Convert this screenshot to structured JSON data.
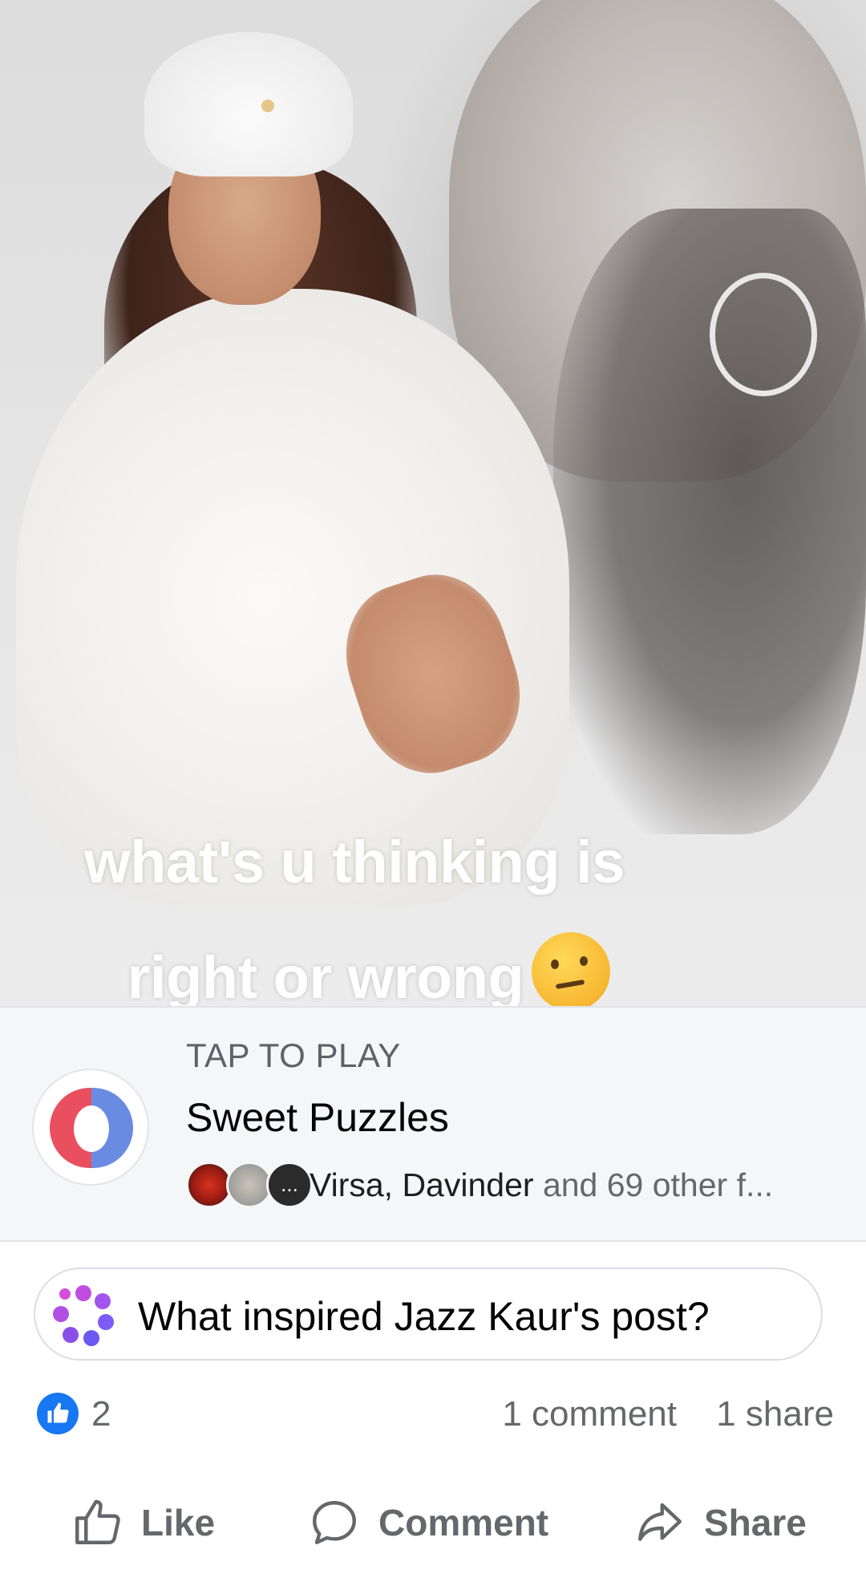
{
  "post": {
    "caption_line1": "what's u thinking is",
    "caption_line2": "right or wrong",
    "caption_emoji": "thinking-face"
  },
  "app_card": {
    "tap_label": "TAP TO PLAY",
    "app_name": "Sweet Puzzles",
    "friends_names": "Virsa, Davinder",
    "friends_rest": " and 69 other f...",
    "avatar_overflow": "..."
  },
  "ai_prompt": {
    "text": "What inspired Jazz Kaur's post?",
    "icon": "ai-sparkle-icon"
  },
  "reactions": {
    "like_count": "2",
    "comment_count": "1 comment",
    "share_count": "1 share",
    "like_color": "#1877f2"
  },
  "actions": {
    "like_label": "Like",
    "comment_label": "Comment",
    "share_label": "Share"
  }
}
